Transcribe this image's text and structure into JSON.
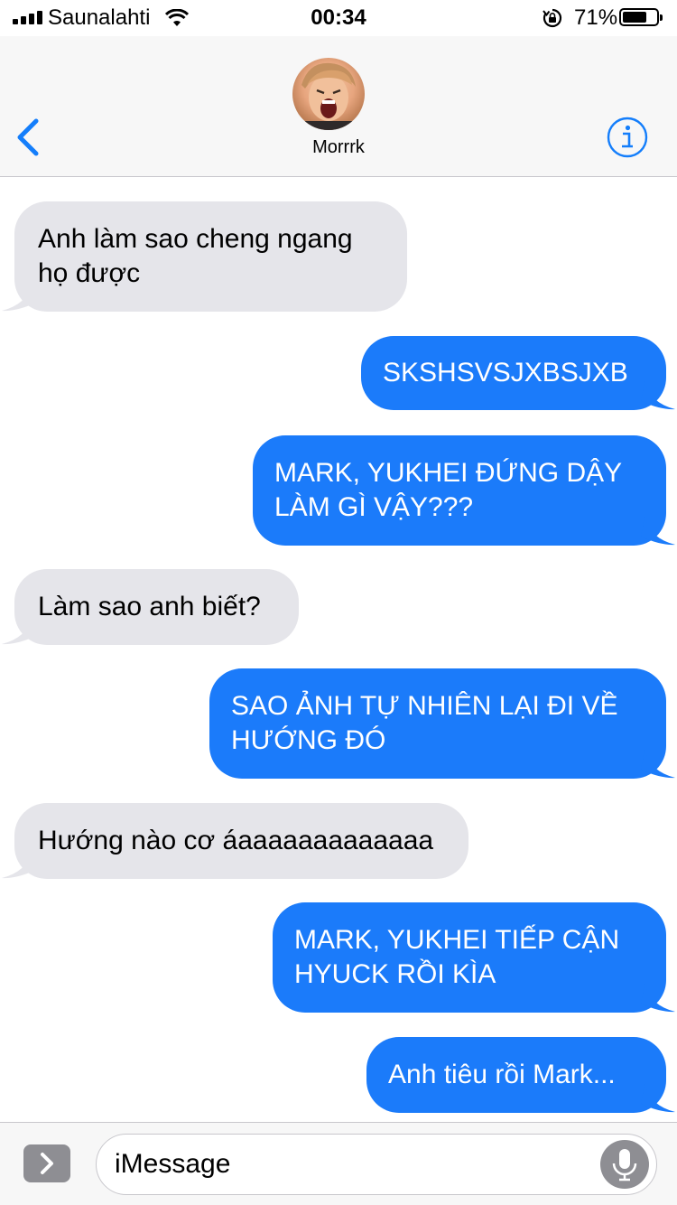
{
  "status_bar": {
    "carrier": "Saunalahti",
    "time": "00:34",
    "battery_percent": "71%",
    "battery_level": 0.71
  },
  "header": {
    "contact_name": "Morrrk",
    "back_icon": "chevron-left-icon",
    "info_icon": "info-icon"
  },
  "messages": [
    {
      "direction": "incoming",
      "text": "Anh làm sao cheng ngang họ được"
    },
    {
      "direction": "outgoing",
      "text": "SKSHSVSJXBSJXB"
    },
    {
      "direction": "outgoing",
      "text": "MARK, YUKHEI ĐỨNG DẬY LÀM GÌ VẬY???"
    },
    {
      "direction": "incoming",
      "text": "Làm sao anh biết?"
    },
    {
      "direction": "outgoing",
      "text": "SAO ẢNH TỰ NHIÊN LẠI ĐI VỀ HƯỚNG ĐÓ"
    },
    {
      "direction": "incoming",
      "text": "Hướng nào cơ áaaaaaaaaaaaaa"
    },
    {
      "direction": "outgoing",
      "text": "MARK, YUKHEI TIẾP CẬN HYUCK RỒI KÌA"
    },
    {
      "direction": "outgoing",
      "text": "Anh tiêu rồi Mark..."
    }
  ],
  "input_bar": {
    "placeholder": "iMessage",
    "apps_icon": "chevron-right-icon",
    "mic_icon": "microphone-icon"
  },
  "colors": {
    "incoming_bubble": "#e5e5ea",
    "outgoing_bubble": "#1b7bfa",
    "accent": "#147efb"
  }
}
